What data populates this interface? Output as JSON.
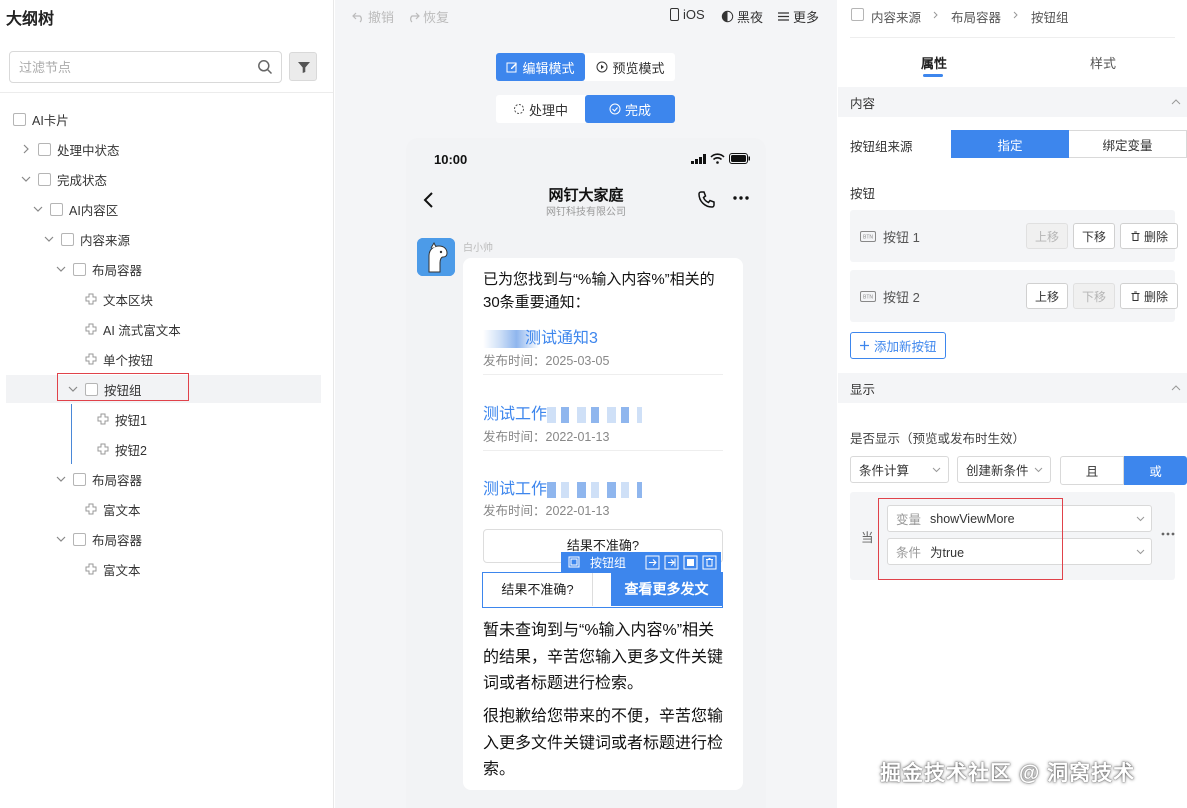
{
  "left": {
    "title": "大纲树",
    "search_placeholder": "过滤节点",
    "tree": [
      {
        "label": "AI卡片"
      },
      {
        "label": "处理中状态"
      },
      {
        "label": "完成状态"
      },
      {
        "label": "AI内容区"
      },
      {
        "label": "内容来源"
      },
      {
        "label": "布局容器"
      },
      {
        "label": "文本区块"
      },
      {
        "label": "AI 流式富文本"
      },
      {
        "label": "单个按钮"
      },
      {
        "label": "按钮组"
      },
      {
        "label": "按钮1"
      },
      {
        "label": "按钮2"
      },
      {
        "label": "布局容器"
      },
      {
        "label": "富文本"
      },
      {
        "label": "布局容器"
      },
      {
        "label": "富文本"
      }
    ]
  },
  "toolbar": {
    "undo": "撤销",
    "redo": "恢复",
    "ios": "iOS",
    "dark": "黑夜",
    "more": "更多"
  },
  "modes": {
    "edit": "编辑模式",
    "preview": "预览模式",
    "processing": "处理中",
    "done": "完成"
  },
  "phone": {
    "time": "10:00",
    "chat_title": "网钉大家庭",
    "chat_subtitle": "网钉科技有限公司",
    "sender": "白小帅",
    "intro": "已为您找到与“%输入内容%”相关的30条重要通知：",
    "notices": [
      {
        "title": "测试通知3",
        "time": "发布时间：2025-03-05"
      },
      {
        "title": "测试工作",
        "time": "发布时间：2022-01-13"
      },
      {
        "title": "测试工作",
        "time": "发布时间：2022-01-13"
      }
    ],
    "ghost_btn": "结果不准确?",
    "float_label": "按钮组",
    "btn_left": "结果不准确?",
    "btn_right": "查看更多发文",
    "para1": "暂未查询到与“%输入内容%”相关的结果，辛苦您输入更多文件关键词或者标题进行检索。",
    "para2": "很抱歉给您带来的不便，辛苦您输入更多文件关键词或者标题进行检索。"
  },
  "right": {
    "crumbs": [
      "内容来源",
      "布局容器",
      "按钮组"
    ],
    "tabs": [
      "属性",
      "样式"
    ],
    "content_section": "内容",
    "source_label": "按钮组来源",
    "source_opts": [
      "指定",
      "绑定变量"
    ],
    "buttons_label": "按钮",
    "buttons": [
      {
        "name": "按钮 1",
        "up": "上移",
        "down": "下移",
        "del": "删除"
      },
      {
        "name": "按钮 2",
        "up": "上移",
        "down": "下移",
        "del": "删除"
      }
    ],
    "add_btn": "添加新按钮",
    "display_section": "显示",
    "show_label": "是否显示（预览或发布时生效）",
    "cond_calc": "条件计算",
    "create_cond": "创建新条件",
    "and": "且",
    "or": "或",
    "when": "当",
    "var_label": "变量",
    "var_value": "showViewMore",
    "cond_label": "条件",
    "cond_value": "为true"
  },
  "watermark": "掘金技术社区 @ 洞窝技术"
}
